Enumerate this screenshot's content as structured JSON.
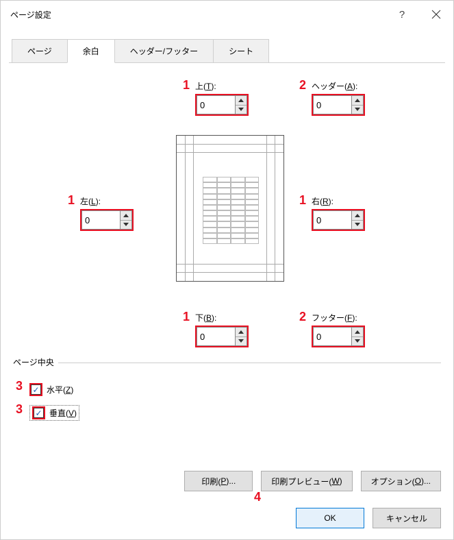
{
  "dialog": {
    "title": "ページ設定",
    "help_tooltip": "?",
    "close_tooltip": "×"
  },
  "tabs": [
    {
      "label": "ページ"
    },
    {
      "label": "余白",
      "active": true
    },
    {
      "label": "ヘッダー/フッター"
    },
    {
      "label": "シート"
    }
  ],
  "margins": {
    "top": {
      "prefix": "上(",
      "mnemonic": "T",
      "suffix": "):",
      "value": "0"
    },
    "header": {
      "prefix": "ヘッダー(",
      "mnemonic": "A",
      "suffix": "):",
      "value": "0"
    },
    "left": {
      "prefix": "左(",
      "mnemonic": "L",
      "suffix": "):",
      "value": "0"
    },
    "right": {
      "prefix": "右(",
      "mnemonic": "R",
      "suffix": "):",
      "value": "0"
    },
    "bottom": {
      "prefix": "下(",
      "mnemonic": "B",
      "suffix": "):",
      "value": "0"
    },
    "footer": {
      "prefix": "フッター(",
      "mnemonic": "F",
      "suffix": "):",
      "value": "0"
    }
  },
  "center_group": {
    "legend": "ページ中央"
  },
  "center": {
    "horizontal": {
      "prefix": "水平(",
      "mnemonic": "Z",
      "suffix": ")",
      "checked": true
    },
    "vertical": {
      "prefix": "垂直(",
      "mnemonic": "V",
      "suffix": ")",
      "checked": true
    }
  },
  "buttons": {
    "print": {
      "prefix": "印刷(",
      "mnemonic": "P",
      "suffix": ")..."
    },
    "preview": {
      "prefix": "印刷プレビュー(",
      "mnemonic": "W",
      "suffix": ")"
    },
    "options": {
      "prefix": "オプション(",
      "mnemonic": "O",
      "suffix": ")..."
    },
    "ok": {
      "label": "OK"
    },
    "cancel": {
      "label": "キャンセル"
    }
  },
  "annotations": {
    "a1": "1",
    "a2": "2",
    "a3": "3",
    "a4": "4"
  }
}
